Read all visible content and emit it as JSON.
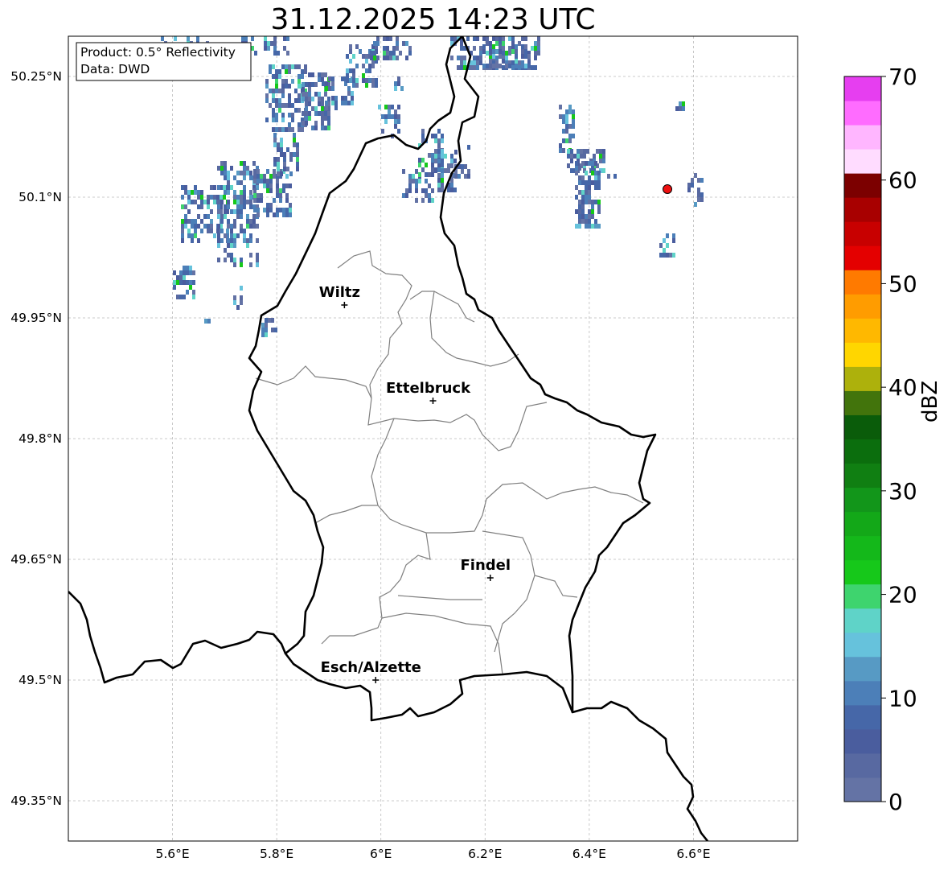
{
  "title": "31.12.2025 14:23 UTC",
  "info_box": {
    "product": "Product: 0.5° Reflectivity",
    "data": "Data: DWD"
  },
  "axes": {
    "x_ticks": [
      "5.6°E",
      "5.8°E",
      "6°E",
      "6.2°E",
      "6.4°E",
      "6.6°E"
    ],
    "y_ticks": [
      "50.25°N",
      "50.1°N",
      "49.95°N",
      "49.8°N",
      "49.65°N",
      "49.5°N",
      "49.35°N"
    ],
    "lon_range": [
      5.4,
      6.8
    ],
    "lat_range": [
      49.3,
      50.3
    ],
    "grid": true
  },
  "cities": [
    {
      "name": "Wiltz",
      "lon": 5.93,
      "lat": 49.966
    },
    {
      "name": "Ettelbruck",
      "lon": 6.1,
      "lat": 49.847
    },
    {
      "name": "Findel",
      "lon": 6.21,
      "lat": 49.627
    },
    {
      "name": "Esch/Alzette",
      "lon": 5.99,
      "lat": 49.5
    }
  ],
  "radar_site": {
    "lon": 6.55,
    "lat": 50.11,
    "color": "#ee1111"
  },
  "colorbar": {
    "label": "dBZ",
    "ticks": [
      "0",
      "10",
      "20",
      "30",
      "40",
      "50",
      "60",
      "70"
    ],
    "range": [
      0,
      70
    ],
    "colors": [
      "#6473a5",
      "#5869a1",
      "#4a5d9e",
      "#4667a8",
      "#4c7fb8",
      "#579ac4",
      "#66c2dc",
      "#5fd3c8",
      "#3ed46e",
      "#16c81a",
      "#14b81a",
      "#13a818",
      "#12961a",
      "#107f12",
      "#0b6e0d",
      "#0a5c0a",
      "#42740c",
      "#adb10c",
      "#ffd600",
      "#ffb800",
      "#ff9c00",
      "#ff7a00",
      "#e40000",
      "#c80000",
      "#a80000",
      "#7c0000",
      "#ffdcff",
      "#ffb6ff",
      "#ff6cff",
      "#e63ef0"
    ]
  }
}
